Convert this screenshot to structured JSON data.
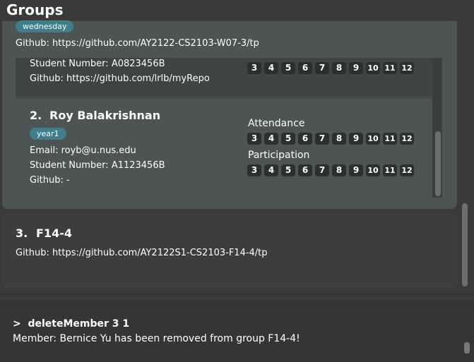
{
  "header": {
    "title": "Groups"
  },
  "group_top": {
    "tag": "wednesday",
    "github": "Github: https://github.com/AY2122-CS2103-W07-3/tp",
    "member_partial": {
      "student_number": "Student Number: A0823456B",
      "github": "Github: https://github.com/lrlb/myRepo",
      "weeks": [
        "3",
        "4",
        "5",
        "6",
        "7",
        "8",
        "9",
        "10",
        "11",
        "12"
      ]
    },
    "member_2": {
      "index": "2.",
      "name": "Roy Balakrishnan",
      "tag": "year1",
      "email": "Email: royb@u.nus.edu",
      "student_number": "Student Number: A1123456B",
      "github": "Github: -",
      "attendance_label": "Attendance",
      "attendance_weeks": [
        "3",
        "4",
        "5",
        "6",
        "7",
        "8",
        "9",
        "10",
        "11",
        "12"
      ],
      "participation_label": "Participation",
      "participation_weeks": [
        "3",
        "4",
        "5",
        "6",
        "7",
        "8",
        "9",
        "10",
        "11",
        "12"
      ]
    }
  },
  "group_3": {
    "index": "3.",
    "name": "F14-4",
    "github": "Github: https://github.com/AY2122S1-CS2103-F14-4/tp"
  },
  "command": {
    "prompt": ">",
    "text": "deleteMember 3 1",
    "result": "Member: Bernice Yu has been removed from group F14-4!"
  }
}
